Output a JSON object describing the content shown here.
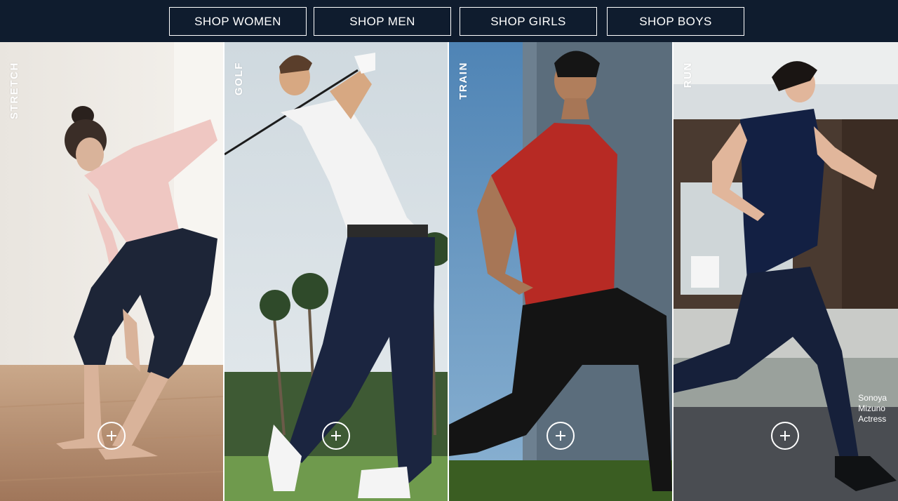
{
  "nav": {
    "buttons": [
      {
        "label": "SHOP WOMEN"
      },
      {
        "label": "SHOP MEN"
      },
      {
        "label": "SHOP GIRLS"
      },
      {
        "label": "SHOP BOYS"
      }
    ]
  },
  "panels": [
    {
      "label": "STRETCH",
      "icon": "plus-circle-icon"
    },
    {
      "label": "GOLF",
      "icon": "plus-circle-icon"
    },
    {
      "label": "TRAIN",
      "icon": "plus-circle-icon"
    },
    {
      "label": "RUN",
      "icon": "plus-circle-icon",
      "caption": [
        "Sonoya",
        "Mizuno",
        "Actress"
      ]
    }
  ],
  "colors": {
    "nav_background": "#0f1c2e",
    "button_border": "#ffffff",
    "text": "#ffffff"
  }
}
